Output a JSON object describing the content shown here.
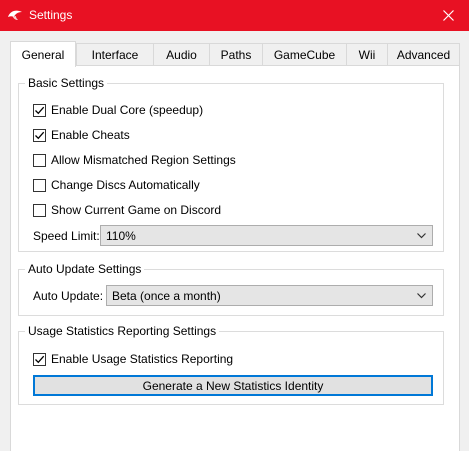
{
  "window": {
    "title": "Settings",
    "titlebar_color": "#e81123"
  },
  "icons": {
    "app": "dolphin-icon",
    "close": "close-icon",
    "check": "checkmark-icon",
    "dropdown": "chevron-down-icon"
  },
  "tabs": [
    {
      "label": "General",
      "active": true
    },
    {
      "label": "Interface",
      "active": false
    },
    {
      "label": "Audio",
      "active": false
    },
    {
      "label": "Paths",
      "active": false
    },
    {
      "label": "GameCube",
      "active": false
    },
    {
      "label": "Wii",
      "active": false
    },
    {
      "label": "Advanced",
      "active": false
    }
  ],
  "basic_settings": {
    "title": "Basic Settings",
    "checkboxes": [
      {
        "label": "Enable Dual Core (speedup)",
        "checked": true
      },
      {
        "label": "Enable Cheats",
        "checked": true
      },
      {
        "label": "Allow Mismatched Region Settings",
        "checked": false
      },
      {
        "label": "Change Discs Automatically",
        "checked": false
      },
      {
        "label": "Show Current Game on Discord",
        "checked": false
      }
    ],
    "speed_limit": {
      "label": "Speed Limit:",
      "value": "110%"
    }
  },
  "auto_update": {
    "title": "Auto Update Settings",
    "field": {
      "label": "Auto Update:",
      "value": "Beta (once a month)"
    }
  },
  "usage_stats": {
    "title": "Usage Statistics Reporting Settings",
    "checkbox": {
      "label": "Enable Usage Statistics Reporting",
      "checked": true
    },
    "button_label": "Generate a New Statistics Identity",
    "focus_color": "#0078d7"
  }
}
